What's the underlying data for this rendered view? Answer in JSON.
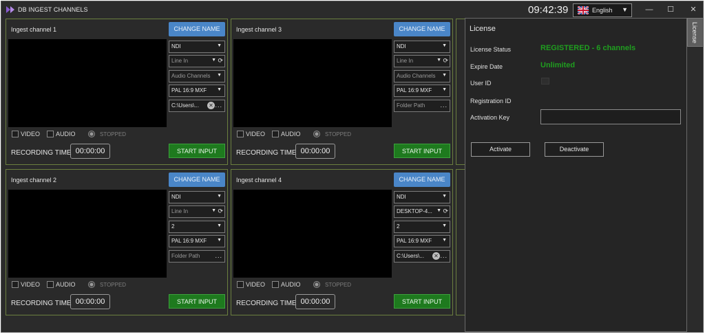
{
  "window": {
    "title": "DB INGEST CHANNELS",
    "clock": "09:42:39",
    "language": "English",
    "icons": {
      "app": "db-logo-icon",
      "flag": "uk-flag-icon",
      "minimize": "minimize-icon",
      "maximize": "maximize-icon",
      "close": "close-icon"
    }
  },
  "common": {
    "change_name": "CHANGE NAME",
    "video": "VIDEO",
    "audio": "AUDIO",
    "stopped": "STOPPED",
    "recording_time": "RECORDING TIME",
    "start_input": "START INPUT"
  },
  "channels": [
    {
      "name": "Ingest channel 1",
      "source": "NDI",
      "audio_input": "Line In",
      "audio_channels": "Audio Channels",
      "format": "PAL 16:9 MXF",
      "folder": "C:\\Users\\...",
      "time": "00:00:00"
    },
    {
      "name": "Ingest channel 2",
      "source": "NDI",
      "audio_input": "Line In",
      "audio_channels": "2",
      "format": "PAL 16:9 MXF",
      "folder": "Folder Path",
      "time": "00:00:00"
    },
    {
      "name": "Ingest channel 3",
      "source": "NDI",
      "audio_input": "Line In",
      "audio_channels": "Audio Channels",
      "format": "PAL 16:9 MXF",
      "folder": "Folder Path",
      "time": "00:00:00"
    },
    {
      "name": "Ingest channel 4",
      "source": "NDI",
      "audio_input": "DESKTOP-4...",
      "audio_channels": "2",
      "format": "PAL 16:9 MXF",
      "folder": "C:\\Users\\...",
      "time": "00:00:00"
    }
  ],
  "license": {
    "title": "License",
    "tab_label": "License",
    "status_label": "License Status",
    "status_value": "REGISTERED - 6 channels",
    "expire_label": "Expire Date",
    "expire_value": "Unlimited",
    "user_id_label": "User ID",
    "registration_id_label": "Registration ID",
    "activation_key_label": "Activation Key",
    "activation_key_value": "",
    "activate": "Activate",
    "deactivate": "Deactivate"
  },
  "colors": {
    "accent_blue": "#4a86c8",
    "start_green": "#1e7a1e",
    "registered_green": "#1f9e1f",
    "panel_border": "#6b7f3f",
    "background": "#2b2b2b"
  }
}
